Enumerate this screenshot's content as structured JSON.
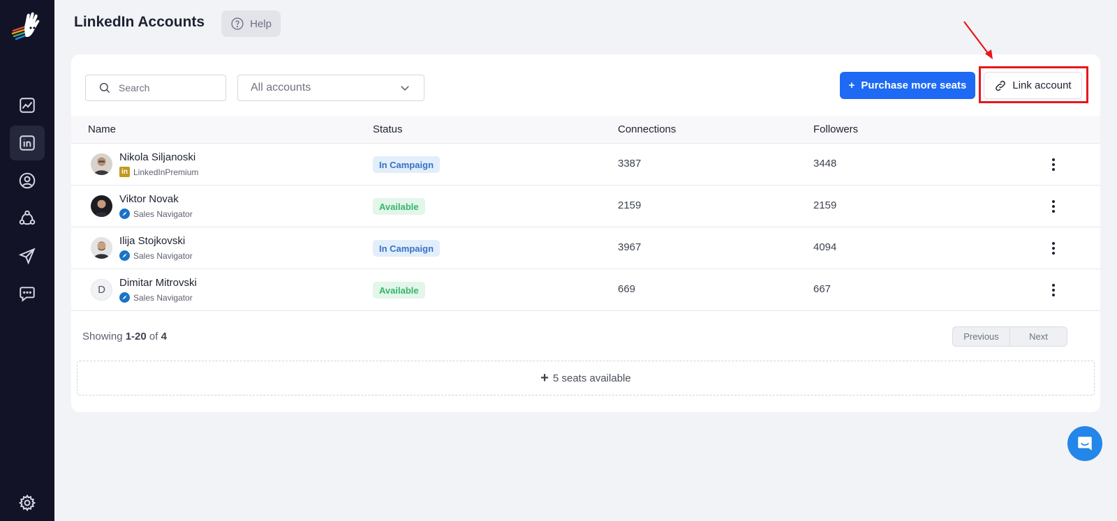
{
  "header": {
    "title": "LinkedIn Accounts",
    "help_label": "Help"
  },
  "toolbar": {
    "search_placeholder": "Search",
    "filter_value": "All accounts",
    "purchase_label": "Purchase more seats",
    "purchase_plus": "+",
    "link_label": "Link account"
  },
  "table": {
    "columns": [
      "Name",
      "Status",
      "Connections",
      "Followers"
    ],
    "rows": [
      {
        "name": "Nikola Siljanoski",
        "subscription": "LinkedInPremium",
        "subscription_type": "premium",
        "status": "In Campaign",
        "connections": "3387",
        "followers": "3448",
        "avatar": "photo"
      },
      {
        "name": "Viktor Novak",
        "subscription": "Sales Navigator",
        "subscription_type": "navigator",
        "status": "Available",
        "connections": "2159",
        "followers": "2159",
        "avatar": "photo"
      },
      {
        "name": "Ilija Stojkovski",
        "subscription": "Sales Navigator",
        "subscription_type": "navigator",
        "status": "In Campaign",
        "connections": "3967",
        "followers": "4094",
        "avatar": "photo"
      },
      {
        "name": "Dimitar Mitrovski",
        "subscription": "Sales Navigator",
        "subscription_type": "navigator",
        "status": "Available",
        "connections": "669",
        "followers": "667",
        "avatar_initial": "D"
      }
    ]
  },
  "footer": {
    "showing_prefix": "Showing",
    "showing_range": "1-20",
    "showing_of": "of",
    "showing_total": "4",
    "prev_label": "Previous",
    "next_label": "Next",
    "seats_plus": "+",
    "seats_label": "5 seats available"
  },
  "sidebar": {
    "items": [
      "chart-icon",
      "linkedin-icon",
      "user-icon",
      "network-icon",
      "send-icon",
      "chat-icon"
    ],
    "active": "linkedin-icon",
    "settings": "gear-icon"
  },
  "colors": {
    "primary": "#1e6af4",
    "sidebar_bg": "#121327",
    "campaign_text": "#3772c4",
    "available_text": "#38b46b",
    "highlight": "#e8161c"
  }
}
